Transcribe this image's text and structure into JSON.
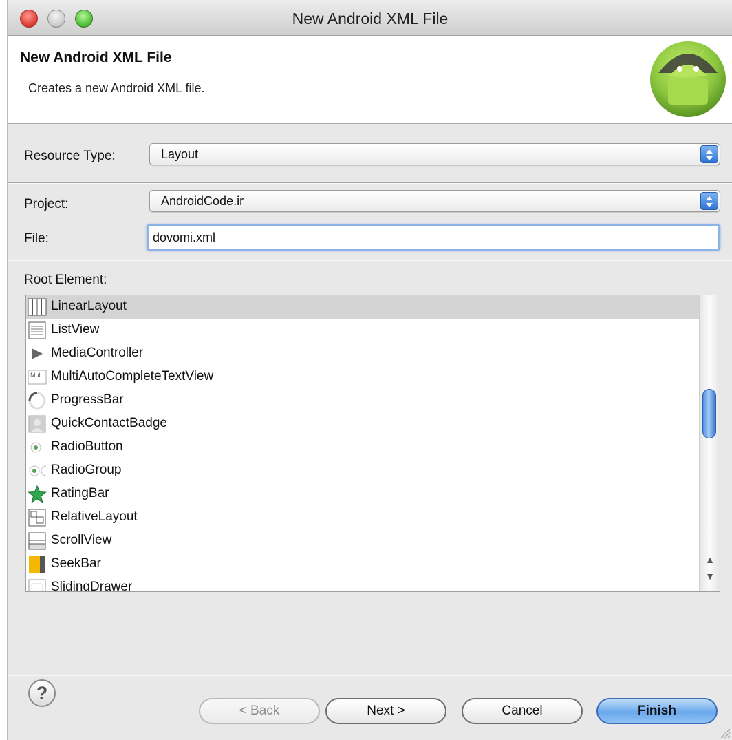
{
  "window": {
    "title": "New Android XML File"
  },
  "header": {
    "title": "New Android XML File",
    "description": "Creates a new Android XML file."
  },
  "form": {
    "resource_type_label": "Resource Type:",
    "resource_type_value": "Layout",
    "project_label": "Project:",
    "project_value": "AndroidCode.ir",
    "file_label": "File:",
    "file_value": "dovomi.xml",
    "root_element_label": "Root Element:"
  },
  "root_elements": [
    {
      "label": "LinearLayout",
      "icon": "linear-layout-icon",
      "selected": true
    },
    {
      "label": "ListView",
      "icon": "list-view-icon"
    },
    {
      "label": "MediaController",
      "icon": "play-triangle-icon"
    },
    {
      "label": "MultiAutoCompleteTextView",
      "icon": "multi-autocomplete-icon",
      "icon_text": "Mul"
    },
    {
      "label": "ProgressBar",
      "icon": "progress-ring-icon"
    },
    {
      "label": "QuickContactBadge",
      "icon": "contact-badge-icon"
    },
    {
      "label": "RadioButton",
      "icon": "radio-button-icon"
    },
    {
      "label": "RadioGroup",
      "icon": "radio-group-icon"
    },
    {
      "label": "RatingBar",
      "icon": "star-icon"
    },
    {
      "label": "RelativeLayout",
      "icon": "relative-layout-icon"
    },
    {
      "label": "ScrollView",
      "icon": "scroll-view-icon"
    },
    {
      "label": "SeekBar",
      "icon": "seek-bar-icon"
    },
    {
      "label": "SlidingDrawer",
      "icon": "sliding-drawer-icon"
    }
  ],
  "buttons": {
    "back": "< Back",
    "next": "Next >",
    "cancel": "Cancel",
    "finish": "Finish",
    "help": "?"
  }
}
